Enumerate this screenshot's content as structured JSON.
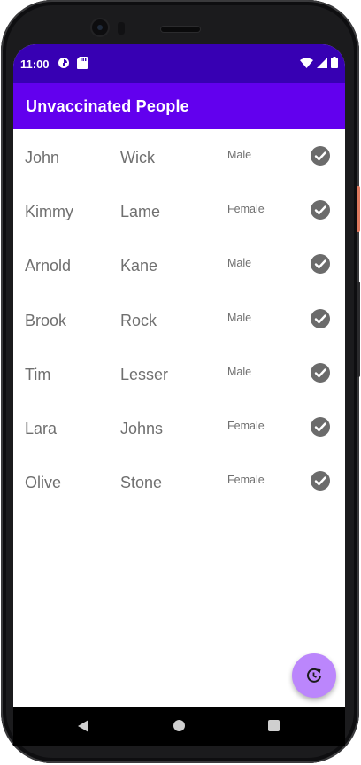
{
  "status_bar": {
    "time": "11:00",
    "left_icons": [
      "sync-icon",
      "sd-card-icon"
    ],
    "right_icons": [
      "wifi-icon",
      "signal-icon",
      "battery-icon"
    ],
    "background": "#3700b3"
  },
  "app_bar": {
    "title": "Unvaccinated People",
    "background": "#6200ee"
  },
  "people": [
    {
      "first": "John",
      "last": "Wick",
      "gender": "Male"
    },
    {
      "first": "Kimmy",
      "last": "Lame",
      "gender": "Female"
    },
    {
      "first": "Arnold",
      "last": "Kane",
      "gender": "Male"
    },
    {
      "first": "Brook",
      "last": "Rock",
      "gender": "Male"
    },
    {
      "first": "Tim",
      "last": "Lesser",
      "gender": "Male"
    },
    {
      "first": "Lara",
      "last": "Johns",
      "gender": "Female"
    },
    {
      "first": "Olive",
      "last": "Stone",
      "gender": "Female"
    }
  ],
  "row_icon": "check-circle-icon",
  "fab": {
    "icon": "refresh-icon",
    "background": "#bb86fc"
  },
  "nav_bar": {
    "icons": [
      "back-icon",
      "home-icon",
      "recents-icon"
    ]
  }
}
